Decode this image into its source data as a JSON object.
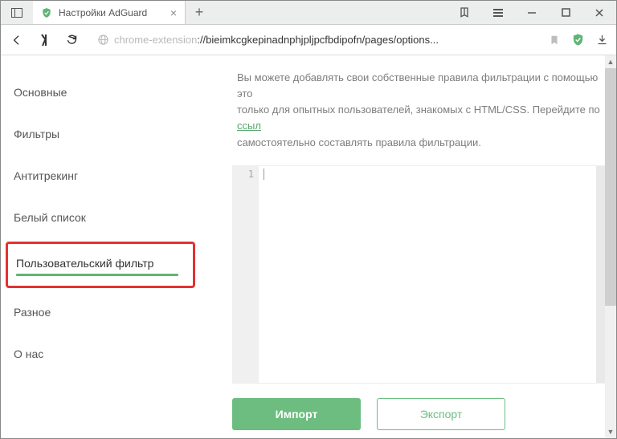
{
  "tab": {
    "title": "Настройки AdGuard"
  },
  "url": {
    "prefix": "chrome-extension",
    "rest": "://bieimkcgkepinadnphjpljpcfbdipofn/pages/options..."
  },
  "sidebar": {
    "items": [
      {
        "label": "Основные"
      },
      {
        "label": "Фильтры"
      },
      {
        "label": "Антитрекинг"
      },
      {
        "label": "Белый список"
      },
      {
        "label": "Пользовательский фильтр"
      },
      {
        "label": "Разное"
      },
      {
        "label": "О нас"
      }
    ]
  },
  "content": {
    "desc_1": "Вы можете добавлять свои собственные правила фильтрации с помощью это",
    "desc_2": "только для опытных пользователей, знакомых с HTML/CSS. Перейдите по ",
    "desc_link": "ссыл",
    "desc_3": "самостоятельно составлять правила фильтрации."
  },
  "editor": {
    "line_number": "1"
  },
  "buttons": {
    "import": "Импорт",
    "export": "Экспорт"
  }
}
